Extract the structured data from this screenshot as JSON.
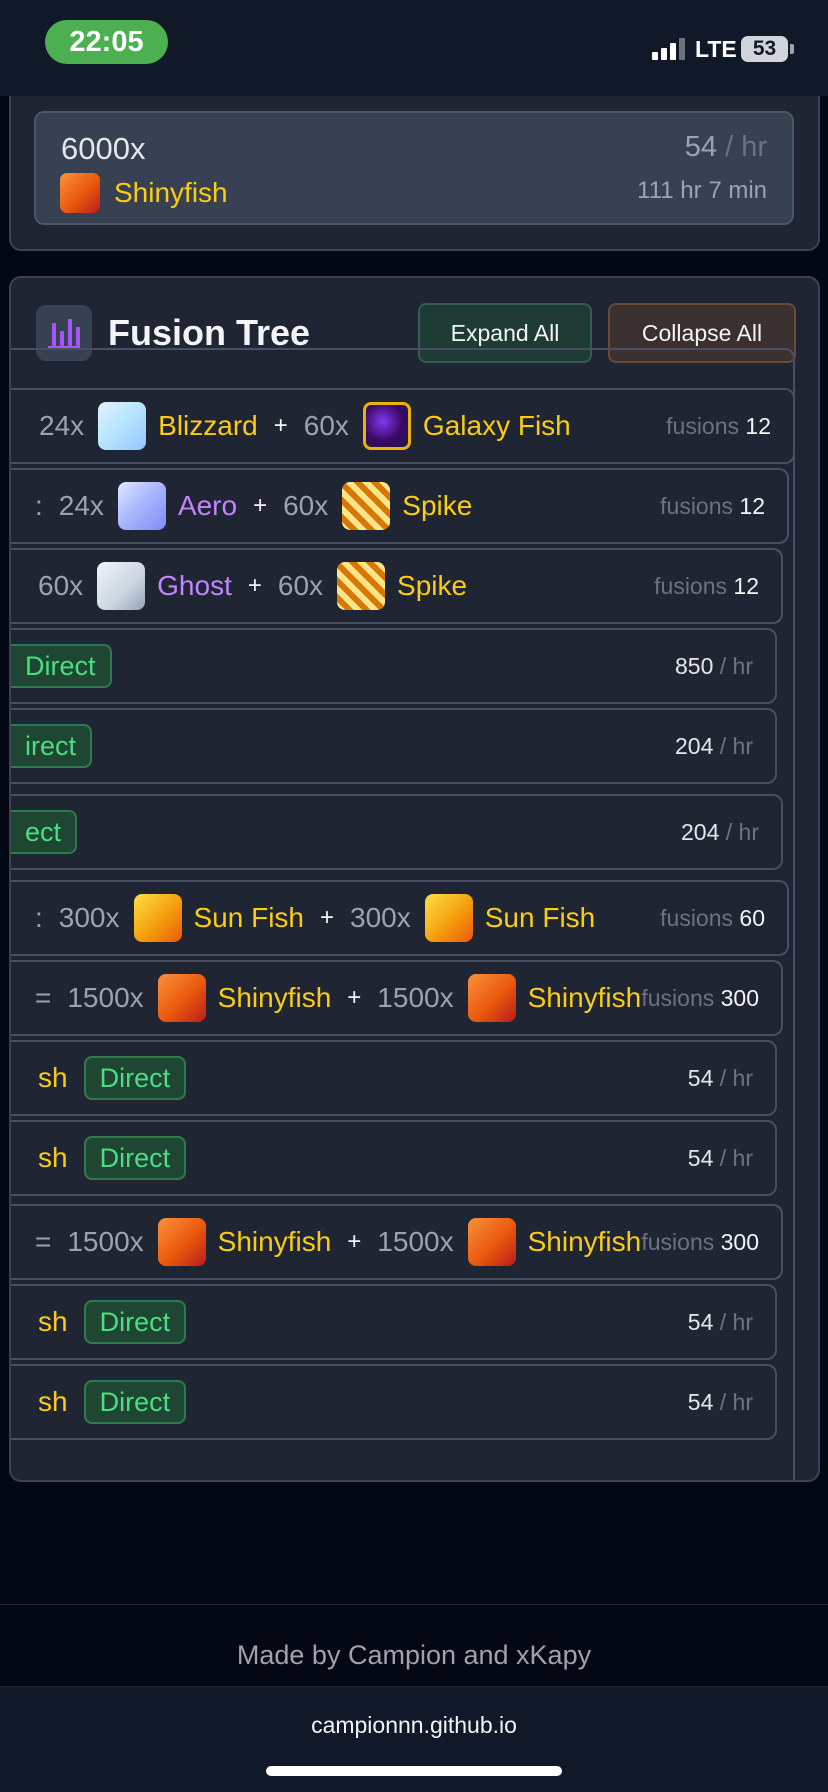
{
  "status_bar": {
    "time": "22:05",
    "network": "LTE",
    "battery": "53"
  },
  "summary": {
    "quantity": "6000x",
    "rate_value": "54",
    "rate_unit": "/ hr",
    "fish_name": "Shinyfish",
    "duration": "111 hr 7 min"
  },
  "fusion_tree": {
    "title": "Fusion Tree",
    "expand_label": "Expand All",
    "collapse_label": "Collapse All",
    "rows": [
      {
        "prefix": "",
        "left_qty": "24x",
        "left_name": "Blizzard",
        "plus": "+",
        "right_qty": "60x",
        "right_name": "Galaxy Fish",
        "fusions_label": "fusions",
        "fusions_value": "12"
      },
      {
        "prefix": ":",
        "left_qty": "24x",
        "left_name": "Aero",
        "plus": "+",
        "right_qty": "60x",
        "right_name": "Spike",
        "fusions_label": "fusions",
        "fusions_value": "12"
      },
      {
        "prefix": "",
        "left_qty": "60x",
        "left_name": "Ghost",
        "plus": "+",
        "right_qty": "60x",
        "right_name": "Spike",
        "fusions_label": "fusions",
        "fusions_value": "12"
      },
      {
        "badge": "Direct",
        "rate_value": "850",
        "rate_unit": "/ hr"
      },
      {
        "badge": "irect",
        "rate_value": "204",
        "rate_unit": "/ hr"
      },
      {
        "badge": "ect",
        "rate_value": "204",
        "rate_unit": "/ hr"
      },
      {
        "prefix": ":",
        "left_qty": "300x",
        "left_name": "Sun Fish",
        "plus": "+",
        "right_qty": "300x",
        "right_name": "Sun Fish",
        "fusions_label": "fusions",
        "fusions_value": "60"
      },
      {
        "prefix": "=",
        "left_qty": "1500x",
        "left_name": "Shinyfish",
        "plus": "+",
        "right_qty": "1500x",
        "right_name": "Shinyfish",
        "fusions_label": "fusions",
        "fusions_value": "300"
      },
      {
        "name_tail": "sh",
        "badge": "Direct",
        "rate_value": "54",
        "rate_unit": "/ hr"
      },
      {
        "name_tail": "sh",
        "badge": "Direct",
        "rate_value": "54",
        "rate_unit": "/ hr"
      },
      {
        "prefix": "=",
        "left_qty": "1500x",
        "left_name": "Shinyfish",
        "plus": "+",
        "right_qty": "1500x",
        "right_name": "Shinyfish",
        "fusions_label": "fusions",
        "fusions_value": "300"
      },
      {
        "name_tail": "sh",
        "badge": "Direct",
        "rate_value": "54",
        "rate_unit": "/ hr"
      },
      {
        "name_tail": "sh",
        "badge": "Direct",
        "rate_value": "54",
        "rate_unit": "/ hr"
      }
    ]
  },
  "footer": {
    "credits": "Made by Campion and xKapy",
    "url": "campionnn.github.io"
  },
  "colors": {
    "accent_yellow": "#facc15",
    "accent_purple": "#c084fc",
    "direct_green": "#4ade80",
    "card_bg": "#1f2533",
    "page_bg": "#040714"
  }
}
